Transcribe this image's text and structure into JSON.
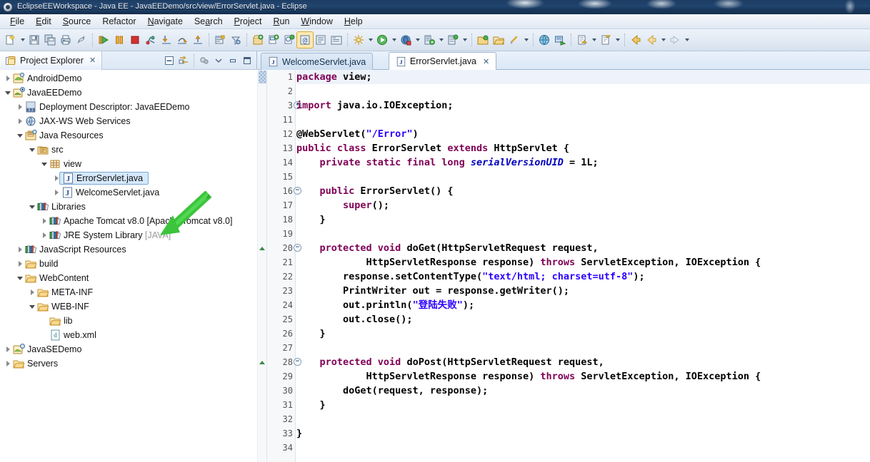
{
  "window": {
    "title": "EclipseEEWorkspace - Java EE - JavaEEDemo/src/view/ErrorServlet.java - Eclipse",
    "app_icon": "eclipse-icon"
  },
  "menubar": {
    "items": [
      {
        "label": "File",
        "mnemonic": "F"
      },
      {
        "label": "Edit",
        "mnemonic": "E"
      },
      {
        "label": "Source",
        "mnemonic": "S"
      },
      {
        "label": "Refactor",
        "mnemonic": ""
      },
      {
        "label": "Navigate",
        "mnemonic": "N"
      },
      {
        "label": "Search",
        "mnemonic": "a"
      },
      {
        "label": "Project",
        "mnemonic": "P"
      },
      {
        "label": "Run",
        "mnemonic": "R"
      },
      {
        "label": "Window",
        "mnemonic": "W"
      },
      {
        "label": "Help",
        "mnemonic": "H"
      }
    ]
  },
  "toolbar": {
    "groups": [
      {
        "buttons": [
          {
            "icon": "new-wizard-icon",
            "dropdown": true
          },
          {
            "icon": "save-icon",
            "dropdown": false
          },
          {
            "icon": "save-all-icon",
            "dropdown": false
          },
          {
            "icon": "print-icon",
            "dropdown": false
          },
          {
            "icon": "toggle-markoccurrences-icon",
            "dropdown": false
          }
        ]
      },
      {
        "buttons": [
          {
            "icon": "resume-icon",
            "dropdown": false
          },
          {
            "icon": "suspend-icon",
            "dropdown": false
          },
          {
            "icon": "terminate-icon",
            "dropdown": false
          },
          {
            "icon": "disconnect-icon",
            "dropdown": false
          },
          {
            "icon": "step-into-icon",
            "dropdown": false
          },
          {
            "icon": "step-over-icon",
            "dropdown": false
          },
          {
            "icon": "step-return-icon",
            "dropdown": false
          }
        ]
      },
      {
        "buttons": [
          {
            "icon": "open-type-icon",
            "dropdown": false
          },
          {
            "icon": "search-icon",
            "dropdown": false
          }
        ]
      },
      {
        "buttons": [
          {
            "icon": "new-java-package-icon",
            "dropdown": false
          },
          {
            "icon": "new-java-class-icon",
            "dropdown": false
          },
          {
            "icon": "new-java-interface-icon",
            "dropdown": false
          },
          {
            "icon": "new-annotation-icon",
            "dropdown": false
          },
          {
            "icon": "new-enum-icon",
            "dropdown": false
          },
          {
            "icon": "new-source-folder-icon",
            "dropdown": false
          }
        ]
      },
      {
        "buttons": [
          {
            "icon": "external-tools-icon",
            "dropdown": true
          },
          {
            "icon": "run-icon",
            "dropdown": true
          },
          {
            "icon": "debug-icon",
            "dropdown": true
          },
          {
            "icon": "run-server-icon",
            "dropdown": true
          },
          {
            "icon": "new-server-icon",
            "dropdown": true
          }
        ]
      },
      {
        "buttons": [
          {
            "icon": "open-task-icon",
            "dropdown": false
          },
          {
            "icon": "open-folder-icon",
            "dropdown": false
          },
          {
            "icon": "link-icon",
            "dropdown": true
          }
        ]
      },
      {
        "buttons": [
          {
            "icon": "web-browser-icon",
            "dropdown": false
          },
          {
            "icon": "run-as-applet-icon",
            "dropdown": false
          }
        ]
      },
      {
        "buttons": [
          {
            "icon": "next-annotation-icon",
            "dropdown": true
          },
          {
            "icon": "previous-annotation-icon",
            "dropdown": true
          }
        ]
      },
      {
        "buttons": [
          {
            "icon": "back-icon",
            "dropdown": false
          },
          {
            "icon": "forward-back-icon",
            "dropdown": true
          },
          {
            "icon": "forward-icon",
            "dropdown": true
          }
        ]
      }
    ]
  },
  "explorer": {
    "tab_label": "Project Explorer",
    "tab_icon": "project-explorer-icon",
    "close_glyph": "✕",
    "tools": [
      {
        "name": "collapse-all-icon"
      },
      {
        "name": "link-with-editor-icon"
      },
      {
        "name": "focus-on-active-task-icon"
      },
      {
        "name": "view-menu-icon"
      },
      {
        "name": "minimize-view-icon"
      },
      {
        "name": "maximize-view-icon"
      }
    ],
    "tree": [
      {
        "label": "AndroidDemo",
        "indent": 1,
        "twisty": "closed",
        "icon": "android-project-icon",
        "selected": false
      },
      {
        "label": "JavaEEDemo",
        "indent": 1,
        "twisty": "open",
        "icon": "javaee-project-icon",
        "selected": false
      },
      {
        "label": "Deployment Descriptor: JavaEEDemo",
        "indent": 2,
        "twisty": "closed",
        "icon": "deployment-descriptor-icon",
        "selected": false
      },
      {
        "label": "JAX-WS Web Services",
        "indent": 2,
        "twisty": "closed",
        "icon": "web-services-icon",
        "selected": false
      },
      {
        "label": "Java Resources",
        "indent": 2,
        "twisty": "open",
        "icon": "java-resources-icon",
        "selected": false
      },
      {
        "label": "src",
        "indent": 3,
        "twisty": "open",
        "icon": "source-folder-icon",
        "selected": false
      },
      {
        "label": "view",
        "indent": 4,
        "twisty": "open",
        "icon": "package-icon",
        "selected": false
      },
      {
        "label": "ErrorServlet.java",
        "indent": 5,
        "twisty": "closed",
        "icon": "java-file-icon",
        "selected": true
      },
      {
        "label": "WelcomeServlet.java",
        "indent": 5,
        "twisty": "closed",
        "icon": "java-file-icon",
        "selected": false
      },
      {
        "label": "Libraries",
        "indent": 3,
        "twisty": "open",
        "icon": "libraries-icon",
        "selected": false
      },
      {
        "label": "Apache Tomcat v8.0 [Apache Tomcat v8.0]",
        "indent": 4,
        "twisty": "closed",
        "icon": "library-icon",
        "selected": false
      },
      {
        "label": "JRE System Library",
        "dim_suffix": " [JAVA]",
        "indent": 4,
        "twisty": "closed",
        "icon": "library-icon",
        "selected": false
      },
      {
        "label": "JavaScript Resources",
        "indent": 2,
        "twisty": "closed",
        "icon": "libraries-icon",
        "selected": false
      },
      {
        "label": "build",
        "indent": 2,
        "twisty": "closed",
        "icon": "folder-icon",
        "selected": false
      },
      {
        "label": "WebContent",
        "indent": 2,
        "twisty": "open",
        "icon": "folder-icon",
        "selected": false
      },
      {
        "label": "META-INF",
        "indent": 3,
        "twisty": "closed",
        "icon": "folder-icon",
        "selected": false
      },
      {
        "label": "WEB-INF",
        "indent": 3,
        "twisty": "open",
        "icon": "folder-icon",
        "selected": false
      },
      {
        "label": "lib",
        "indent": 4,
        "twisty": "none",
        "icon": "folder-icon",
        "selected": false
      },
      {
        "label": "web.xml",
        "indent": 4,
        "twisty": "none",
        "icon": "xml-file-icon",
        "selected": false
      },
      {
        "label": "JavaSEDemo",
        "indent": 1,
        "twisty": "closed",
        "icon": "java-project-icon",
        "selected": false
      },
      {
        "label": "Servers",
        "indent": 1,
        "twisty": "closed",
        "icon": "servers-folder-icon",
        "selected": false
      }
    ]
  },
  "annotation": {
    "arrow_color": "#3cc43c",
    "arrow_name": "green-pointer-arrow",
    "points_to": "ErrorServlet.java"
  },
  "editor": {
    "tabs": [
      {
        "label": "WelcomeServlet.java",
        "icon": "java-file-icon",
        "active": false,
        "closable": false
      },
      {
        "label": "ErrorServlet.java",
        "icon": "java-file-icon",
        "active": true,
        "closable": true,
        "close_glyph": "✕"
      }
    ],
    "lines": [
      {
        "num": "1",
        "fold": "",
        "anno": "",
        "current": true,
        "tokens": [
          {
            "t": "package ",
            "c": "kw"
          },
          {
            "t": "view;",
            "c": "plain"
          }
        ]
      },
      {
        "num": "2",
        "fold": "",
        "anno": "",
        "tokens": []
      },
      {
        "num": "3",
        "fold": "+",
        "anno": "",
        "tokens": [
          {
            "t": "import ",
            "c": "kw"
          },
          {
            "t": "java.io.IOException;",
            "c": "plain"
          }
        ]
      },
      {
        "num": "11",
        "fold": "",
        "anno": "",
        "tokens": []
      },
      {
        "num": "12",
        "fold": "",
        "anno": "",
        "tokens": [
          {
            "t": "@WebServlet(",
            "c": "plain"
          },
          {
            "t": "\"/Error\"",
            "c": "str"
          },
          {
            "t": ")",
            "c": "plain"
          }
        ]
      },
      {
        "num": "13",
        "fold": "",
        "anno": "",
        "tokens": [
          {
            "t": "public class ",
            "c": "kw"
          },
          {
            "t": "ErrorServlet ",
            "c": "plain"
          },
          {
            "t": "extends ",
            "c": "kw"
          },
          {
            "t": "HttpServlet {",
            "c": "plain"
          }
        ]
      },
      {
        "num": "14",
        "fold": "",
        "anno": "",
        "tokens": [
          {
            "t": "    ",
            "c": "plain"
          },
          {
            "t": "private static final long ",
            "c": "kw"
          },
          {
            "t": "serialVersionUID",
            "c": "fld"
          },
          {
            "t": " = 1L;",
            "c": "plain"
          }
        ]
      },
      {
        "num": "15",
        "fold": "",
        "anno": "",
        "tokens": []
      },
      {
        "num": "16",
        "fold": "-",
        "anno": "",
        "tokens": [
          {
            "t": "    ",
            "c": "plain"
          },
          {
            "t": "public ",
            "c": "kw"
          },
          {
            "t": "ErrorServlet() {",
            "c": "plain"
          }
        ]
      },
      {
        "num": "17",
        "fold": "",
        "anno": "",
        "tokens": [
          {
            "t": "        ",
            "c": "plain"
          },
          {
            "t": "super",
            "c": "kw"
          },
          {
            "t": "();",
            "c": "plain"
          }
        ]
      },
      {
        "num": "18",
        "fold": "",
        "anno": "",
        "tokens": [
          {
            "t": "    }",
            "c": "plain"
          }
        ]
      },
      {
        "num": "19",
        "fold": "",
        "anno": "",
        "tokens": []
      },
      {
        "num": "20",
        "fold": "-",
        "anno": "override",
        "tokens": [
          {
            "t": "    ",
            "c": "plain"
          },
          {
            "t": "protected void ",
            "c": "kw"
          },
          {
            "t": "doGet(HttpServletRequest request,",
            "c": "plain"
          }
        ]
      },
      {
        "num": "21",
        "fold": "",
        "anno": "",
        "tokens": [
          {
            "t": "            HttpServletResponse response) ",
            "c": "plain"
          },
          {
            "t": "throws ",
            "c": "kw"
          },
          {
            "t": "ServletException, IOException {",
            "c": "plain"
          }
        ]
      },
      {
        "num": "22",
        "fold": "",
        "anno": "",
        "tokens": [
          {
            "t": "        response.setContentType(",
            "c": "plain"
          },
          {
            "t": "\"text/html; charset=utf-8\"",
            "c": "str"
          },
          {
            "t": ");",
            "c": "plain"
          }
        ]
      },
      {
        "num": "23",
        "fold": "",
        "anno": "",
        "tokens": [
          {
            "t": "        PrintWriter out = response.getWriter();",
            "c": "plain"
          }
        ]
      },
      {
        "num": "24",
        "fold": "",
        "anno": "",
        "tokens": [
          {
            "t": "        out.println(",
            "c": "plain"
          },
          {
            "t": "\"",
            "c": "str"
          },
          {
            "t": "登陆失败",
            "c": "cjk"
          },
          {
            "t": "\"",
            "c": "str"
          },
          {
            "t": ");",
            "c": "plain"
          }
        ]
      },
      {
        "num": "25",
        "fold": "",
        "anno": "",
        "tokens": [
          {
            "t": "        out.close();",
            "c": "plain"
          }
        ]
      },
      {
        "num": "26",
        "fold": "",
        "anno": "",
        "tokens": [
          {
            "t": "    }",
            "c": "plain"
          }
        ]
      },
      {
        "num": "27",
        "fold": "",
        "anno": "",
        "tokens": []
      },
      {
        "num": "28",
        "fold": "-",
        "anno": "override",
        "tokens": [
          {
            "t": "    ",
            "c": "plain"
          },
          {
            "t": "protected void ",
            "c": "kw"
          },
          {
            "t": "doPost(HttpServletRequest request,",
            "c": "plain"
          }
        ]
      },
      {
        "num": "29",
        "fold": "",
        "anno": "",
        "tokens": [
          {
            "t": "            HttpServletResponse response) ",
            "c": "plain"
          },
          {
            "t": "throws ",
            "c": "kw"
          },
          {
            "t": "ServletException, IOException {",
            "c": "plain"
          }
        ]
      },
      {
        "num": "30",
        "fold": "",
        "anno": "",
        "tokens": [
          {
            "t": "        doGet(request, response);",
            "c": "plain"
          }
        ]
      },
      {
        "num": "31",
        "fold": "",
        "anno": "",
        "tokens": [
          {
            "t": "    }",
            "c": "plain"
          }
        ]
      },
      {
        "num": "32",
        "fold": "",
        "anno": "",
        "tokens": []
      },
      {
        "num": "33",
        "fold": "",
        "anno": "",
        "tokens": [
          {
            "t": "}",
            "c": "plain"
          }
        ]
      },
      {
        "num": "34",
        "fold": "",
        "anno": "",
        "tokens": []
      }
    ]
  },
  "colors": {
    "keyword": "#7f0055",
    "string": "#2a00ff",
    "field": "#0000c0",
    "selection": "#d6e8fb",
    "titlebar": "#1d3c63"
  }
}
